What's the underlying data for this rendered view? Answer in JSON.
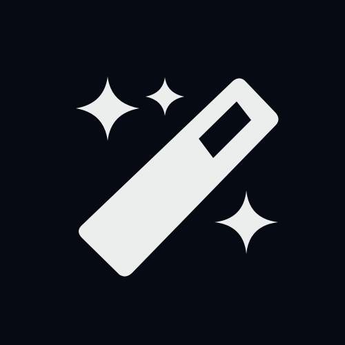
{
  "icon": {
    "name": "magic-wand-icon",
    "description_color": {
      "background": "#060a13",
      "foreground": "#eceeed"
    },
    "sparkles": [
      "sparkle-large",
      "sparkle-small",
      "sparkle-lower"
    ]
  }
}
